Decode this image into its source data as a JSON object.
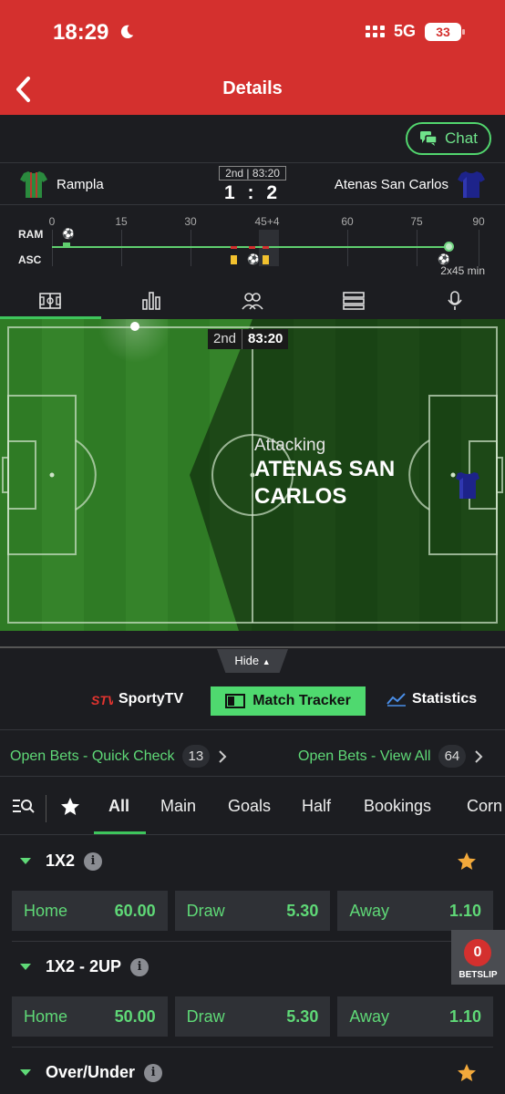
{
  "status_bar": {
    "time": "18:29",
    "network": "5G",
    "battery": "33"
  },
  "header": {
    "title": "Details"
  },
  "chat": {
    "label": "Chat"
  },
  "match": {
    "home_team": "Rampla",
    "away_team": "Atenas San Carlos",
    "period": "2nd",
    "clock": "83:20",
    "score": "1 : 2",
    "home_abbr": "RAM",
    "away_abbr": "ASC",
    "timeline_ticks": [
      "0",
      "15",
      "30",
      "45+4",
      "60",
      "75",
      "90"
    ],
    "duration": "2x45 min"
  },
  "pitch": {
    "period": "2nd",
    "clock": "83:20",
    "attacking_label": "Attacking",
    "attacking_team": "ATENAS SAN CARLOS"
  },
  "hide_label": "Hide",
  "media": {
    "sportytv": "SportyTV",
    "tracker": "Match Tracker",
    "statistics": "Statistics"
  },
  "open_bets": {
    "quick_check_label": "Open Bets - Quick Check",
    "quick_check_count": "13",
    "view_all_label": "Open Bets - View All",
    "view_all_count": "64"
  },
  "market_tabs": [
    "All",
    "Main",
    "Goals",
    "Half",
    "Bookings",
    "Corn"
  ],
  "markets": [
    {
      "title": "1X2",
      "odds": [
        {
          "name": "Home",
          "value": "60.00"
        },
        {
          "name": "Draw",
          "value": "5.30"
        },
        {
          "name": "Away",
          "value": "1.10"
        }
      ]
    },
    {
      "title": "1X2 - 2UP",
      "odds": [
        {
          "name": "Home",
          "value": "50.00"
        },
        {
          "name": "Draw",
          "value": "5.30"
        },
        {
          "name": "Away",
          "value": "1.10"
        }
      ]
    },
    {
      "title": "Over/Under"
    }
  ],
  "betslip": {
    "count": "0",
    "label": "BETSLIP"
  },
  "colors": {
    "brand_red": "#d4302e",
    "accent_green": "#4fd96f",
    "background": "#1c1d21"
  }
}
